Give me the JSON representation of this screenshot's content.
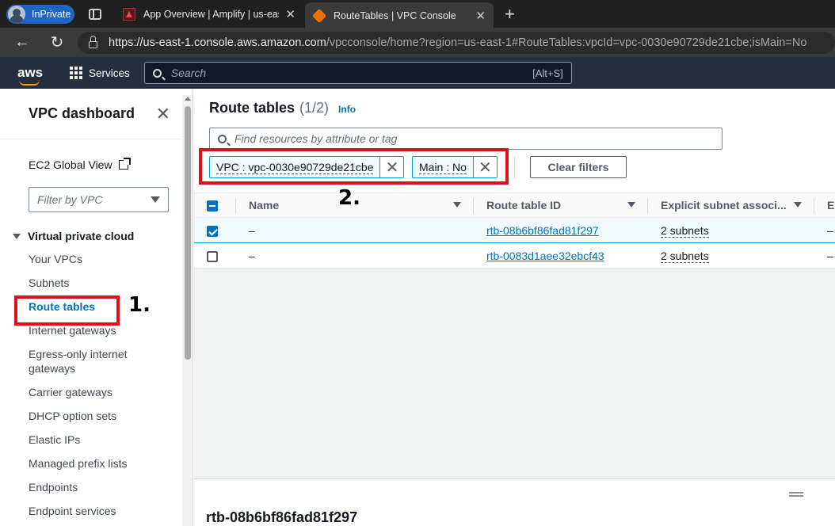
{
  "browser": {
    "profile_label": "InPrivate",
    "tabs": [
      {
        "title": "App Overview | Amplify | us-east",
        "active": false
      },
      {
        "title": "RouteTables | VPC Console",
        "active": true
      }
    ],
    "url_host": "https://us-east-1.console.aws.amazon.com",
    "url_path": "/vpcconsole/home?region=us-east-1#RouteTables:vpcId=vpc-0030e90729de21cbe;isMain=No"
  },
  "aws_nav": {
    "logo": "aws",
    "services_label": "Services",
    "search_placeholder": "Search",
    "search_shortcut": "[Alt+S]"
  },
  "sidebar": {
    "title": "VPC dashboard",
    "global_view": "EC2 Global View",
    "filter_placeholder": "Filter by VPC",
    "section": "Virtual private cloud",
    "items": [
      {
        "label": "Your VPCs"
      },
      {
        "label": "Subnets"
      },
      {
        "label": "Route tables",
        "active": true
      },
      {
        "label": "Internet gateways"
      },
      {
        "label": "Egress-only internet gateways"
      },
      {
        "label": "Carrier gateways"
      },
      {
        "label": "DHCP option sets"
      },
      {
        "label": "Elastic IPs"
      },
      {
        "label": "Managed prefix lists"
      },
      {
        "label": "Endpoints"
      },
      {
        "label": "Endpoint services"
      }
    ]
  },
  "main": {
    "title": "Route tables",
    "count": "(1/2)",
    "info_link": "Info",
    "search_placeholder": "Find resources by attribute or tag",
    "filters": [
      {
        "label": "VPC : vpc-0030e90729de21cbe"
      },
      {
        "label": "Main : No"
      }
    ],
    "clear_filters": "Clear filters",
    "columns": [
      "Name",
      "Route table ID",
      "Explicit subnet associ...",
      "E"
    ],
    "rows": [
      {
        "selected": true,
        "name": "–",
        "id": "rtb-08b6bf86fad81f297",
        "subnets": "2 subnets",
        "extra": "–"
      },
      {
        "selected": false,
        "name": "–",
        "id": "rtb-0083d1aee32ebcf43",
        "subnets": "2 subnets",
        "extra": "–"
      }
    ],
    "detail_title": "rtb-08b6bf86fad81f297"
  },
  "annotations": {
    "label_1": "1.",
    "label_2": "2.",
    "color": "#e0101a"
  }
}
